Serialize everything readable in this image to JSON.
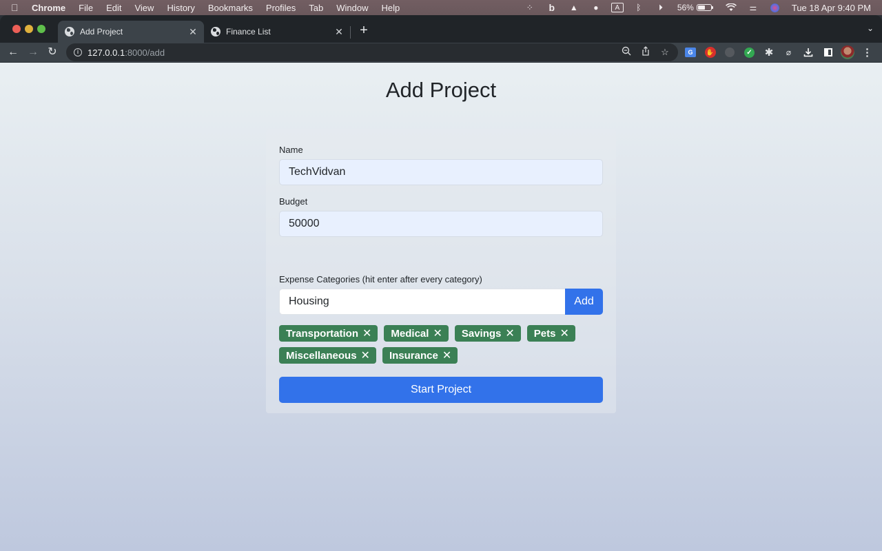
{
  "menubar": {
    "app_name": "Chrome",
    "items": [
      "File",
      "Edit",
      "View",
      "History",
      "Bookmarks",
      "Profiles",
      "Tab",
      "Window",
      "Help"
    ],
    "status_icons": [
      "screen-capture-icon",
      "bing-icon",
      "vlc-icon",
      "app-icon",
      "keyboard-input-a-icon",
      "bluetooth-icon",
      "play-circle-icon"
    ],
    "battery_percent": "56%",
    "battery_level": 0.56,
    "datetime": "Tue 18 Apr  9:40 PM"
  },
  "browser": {
    "tabs": [
      {
        "title": "Add Project",
        "active": true
      },
      {
        "title": "Finance List",
        "active": false
      }
    ],
    "url_host": "127.0.0.1",
    "url_path": ":8000/add"
  },
  "page": {
    "title": "Add Project",
    "form": {
      "name_label": "Name",
      "name_value": "TechVidvan",
      "budget_label": "Budget",
      "budget_value": "50000",
      "categories_label": "Expense Categories (hit enter after every category)",
      "category_input_value": "Housing",
      "add_button_label": "Add",
      "categories": [
        "Transportation",
        "Medical",
        "Savings",
        "Pets",
        "Miscellaneous",
        "Insurance"
      ],
      "remove_glyph": "✕",
      "submit_label": "Start Project"
    }
  },
  "colors": {
    "primary": "#3272ea",
    "tag_green": "#3b8055"
  }
}
